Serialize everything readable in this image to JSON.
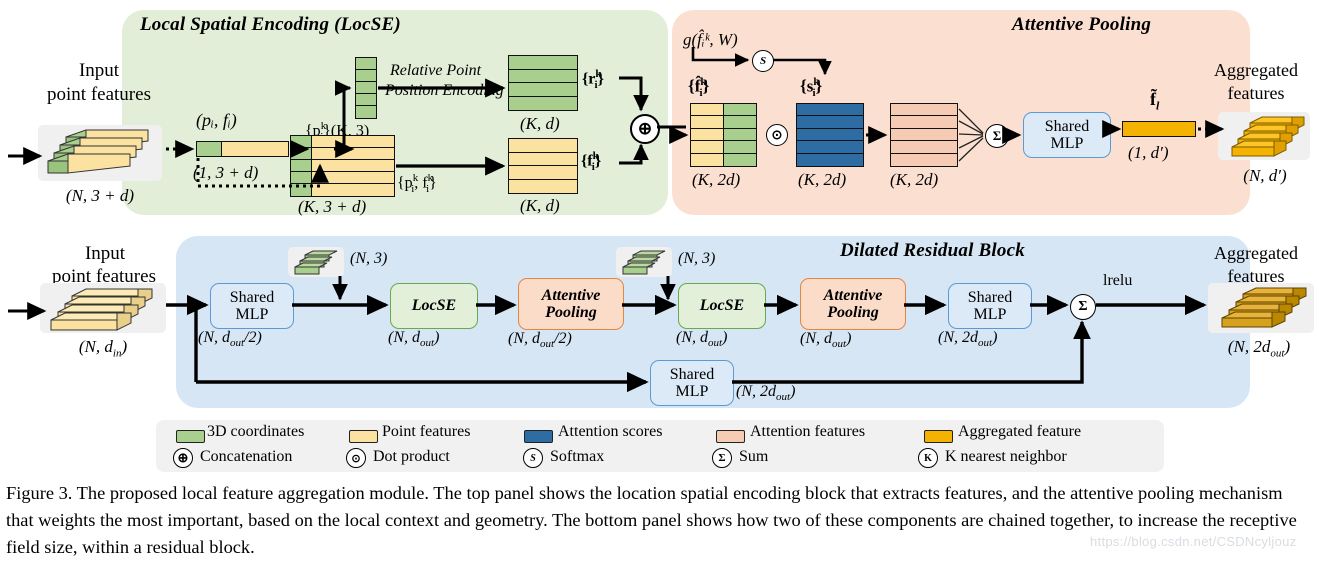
{
  "figure": {
    "number": "Figure 3.",
    "caption": "Figure 3. The proposed local feature aggregation module. The top panel shows the location spatial encoding block that extracts features, and the attentive pooling mechanism that weights the most important, based on the local context and geometry. The bottom panel shows how two of these components are chained together, to increase the receptive field size, within a residual block.",
    "watermark": "https://blog.csdn.net/CSDNcyljouz"
  },
  "panels": {
    "locse": {
      "title": "Local Spatial Encoding (LocSE)",
      "color": "#e3eed8"
    },
    "attentive_pooling": {
      "title": "Attentive Pooling",
      "color": "#fbe0d2"
    },
    "dilated_residual_block": {
      "title": "Dilated Residual Block",
      "color": "#d6e6f5"
    }
  },
  "locse": {
    "input_title_line1": "Input",
    "input_title_line2": "point features",
    "input_shape": "(N, 3 + d)",
    "point_pair": "(pᵢ, fᵢ)",
    "point_pair_shape": "(1, 3 + d)",
    "knn_icon": "K",
    "neighbor_points_label": "{p",
    "neighbor_points_sup": "k",
    "neighbor_points_sub": "i",
    "neighbor_points_shape": "}(K, 3)",
    "rppe_line1": "Relative Point",
    "rppe_line2": "Position Encoding",
    "r_label": "{r",
    "r_shape": "(K, d)",
    "pf_label": "{p",
    "pf_label2": ", f",
    "pf_shape": "(K, 3 + d)",
    "f_label": "{f",
    "f_shape": "(K, d)",
    "concat_icon": "⊕"
  },
  "attentive_pooling": {
    "g_function": "g(f̂ᵢᵏ, W)",
    "softmax_icon": "S",
    "fhat_label": "{f̂",
    "s_label": "{s",
    "fhat_shape": "(K, 2d)",
    "s_shape": "(K, 2d)",
    "attfeat_shape": "(K, 2d)",
    "dot_icon": "⊙",
    "sum_icon": "Σ",
    "mlp_line1": "Shared",
    "mlp_line2": "MLP",
    "ftilde_label": "f̃",
    "ftilde_sub": "l",
    "ftilde_shape": "(1, d′)",
    "output_title_line1": "Aggregated",
    "output_title_line2": "features",
    "output_shape": "(N, d′)"
  },
  "residual_block": {
    "input_title_line1": "Input",
    "input_title_line2": "point features",
    "input_shape": "(N, dᵢₙ)",
    "mlp1_line1": "Shared",
    "mlp1_line2": "MLP",
    "mlp1_shape": "(N, d_out/2)",
    "coords1_shape": "(N, 3)",
    "locse1_label": "LocSE",
    "locse1_shape": "(N, d_out)",
    "attpool1_line1": "Attentive",
    "attpool1_line2": "Pooling",
    "attpool1_shape": "(N, d_out/2)",
    "coords2_shape": "(N, 3)",
    "locse2_label": "LocSE",
    "locse2_shape": "(N, d_out)",
    "attpool2_line1": "Attentive",
    "attpool2_line2": "Pooling",
    "attpool2_shape": "(N, d_out)",
    "mlp2_line1": "Shared",
    "mlp2_line2": "MLP",
    "mlp2_shape": "(N, 2d_out)",
    "skip_mlp_line1": "Shared",
    "skip_mlp_line2": "MLP",
    "skip_mlp_shape": "(N, 2d_out)",
    "sum_icon": "Σ",
    "activation": "lrelu",
    "output_title_line1": "Aggregated",
    "output_title_line2": "features",
    "output_shape": "(N, 2d_out)"
  },
  "legend": {
    "row1": [
      {
        "label": "3D coordinates",
        "color": "#a9cf8f",
        "icon": "color-swatch"
      },
      {
        "label": "Point features",
        "color": "#fbe2a0",
        "icon": "color-swatch"
      },
      {
        "label": "Attention scores",
        "color": "#2e6da4",
        "icon": "color-swatch"
      },
      {
        "label": "Attention features",
        "color": "#f6cbb4",
        "icon": "color-swatch"
      },
      {
        "label": "Aggregated feature",
        "color": "#f5b301",
        "icon": "color-swatch"
      }
    ],
    "row2": [
      {
        "label": "Concatenation",
        "icon": "⊕"
      },
      {
        "label": "Dot product",
        "icon": "⊙"
      },
      {
        "label": "Softmax",
        "icon": "S"
      },
      {
        "label": "Sum",
        "icon": "Σ"
      },
      {
        "label": "K nearest neighbor",
        "icon": "K"
      }
    ]
  },
  "colors": {
    "green_coords": "#a9cf8f",
    "yellow_features": "#fbe2a0",
    "blue_scores": "#2e6da4",
    "salmon_attention": "#f6cbb4",
    "amber_aggregated": "#f5b301",
    "panel_green": "#e3eed8",
    "panel_peach": "#fbe0d2",
    "panel_blue": "#d6e6f5",
    "mlp_border": "#5b9bd5",
    "mlp_fill": "#dce9f7",
    "locse_border": "#6aa84f",
    "attpool_border": "#e8853c"
  }
}
